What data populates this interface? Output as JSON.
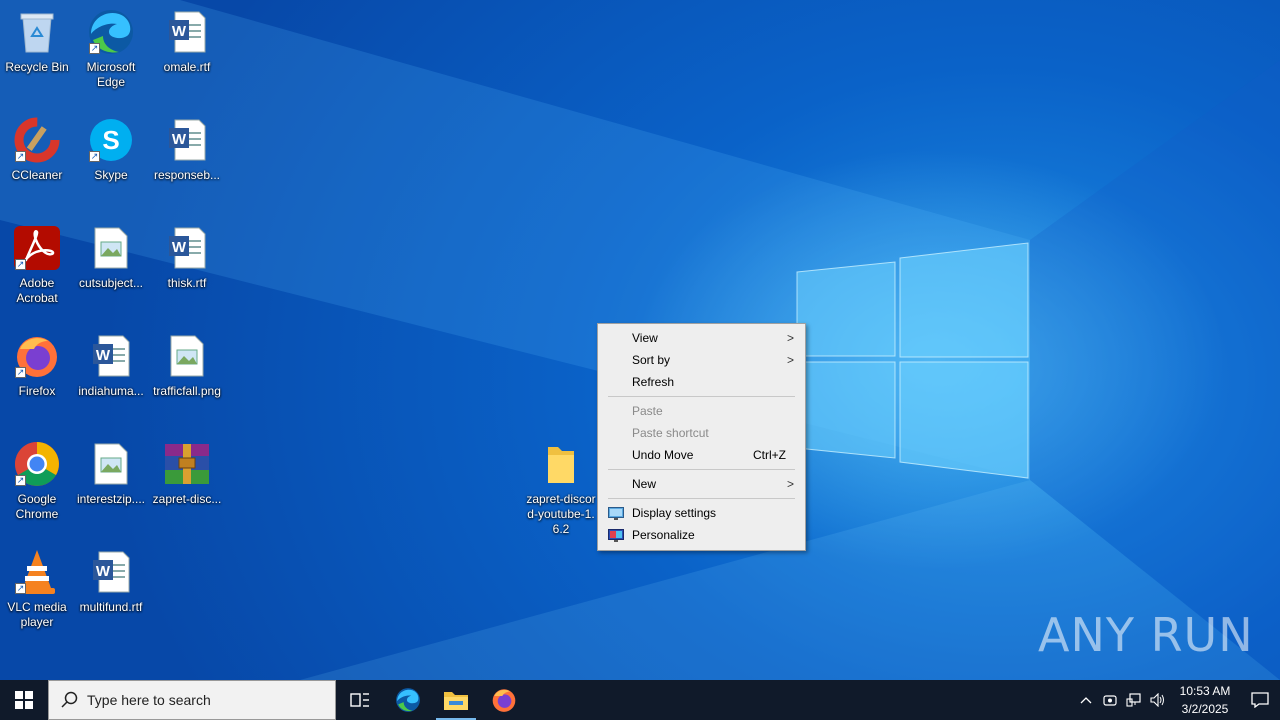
{
  "desktop": {
    "icons": [
      {
        "label": "Recycle Bin",
        "icon": "recycle-bin-icon"
      },
      {
        "label": "Microsoft Edge",
        "icon": "edge-icon"
      },
      {
        "label": "omale.rtf",
        "icon": "word-document-icon"
      },
      {
        "label": "CCleaner",
        "icon": "ccleaner-icon"
      },
      {
        "label": "Skype",
        "icon": "skype-icon"
      },
      {
        "label": "responseb...",
        "icon": "word-document-icon"
      },
      {
        "label": "Adobe Acrobat",
        "icon": "acrobat-icon"
      },
      {
        "label": "cutsubject...",
        "icon": "image-file-icon"
      },
      {
        "label": "thisk.rtf",
        "icon": "word-document-icon"
      },
      {
        "label": "Firefox",
        "icon": "firefox-icon"
      },
      {
        "label": "indiahuma...",
        "icon": "word-document-icon"
      },
      {
        "label": "trafficfall.png",
        "icon": "image-file-icon"
      },
      {
        "label": "Google Chrome",
        "icon": "chrome-icon"
      },
      {
        "label": "interestzip....",
        "icon": "image-file-icon"
      },
      {
        "label": "zapret-disc...",
        "icon": "winrar-archive-icon"
      },
      {
        "label": "VLC media player",
        "icon": "vlc-icon"
      },
      {
        "label": "multifund.rtf",
        "icon": "word-document-icon"
      },
      {
        "label": "zapret-discord-youtube-1.6.2",
        "icon": "folder-icon"
      }
    ]
  },
  "context_menu": {
    "view": "View",
    "sort_by": "Sort by",
    "refresh": "Refresh",
    "paste": "Paste",
    "paste_shortcut": "Paste shortcut",
    "undo_move": "Undo Move",
    "undo_shortcut": "Ctrl+Z",
    "new": "New",
    "display_settings": "Display settings",
    "personalize": "Personalize"
  },
  "taskbar": {
    "search_placeholder": "Type here to search",
    "time": "10:53 AM",
    "date": "3/2/2025"
  },
  "watermark": "ANY RUN",
  "colors": {
    "accent": "#0a62c8",
    "taskbar": "#101a2a",
    "menu_bg": "#eeeeee"
  }
}
